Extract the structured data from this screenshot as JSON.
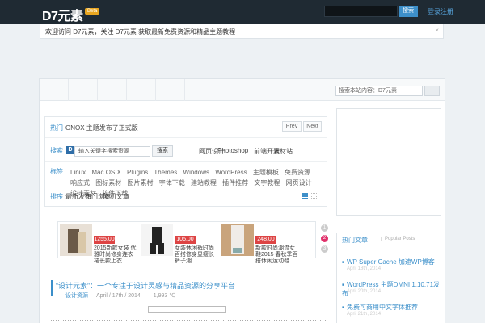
{
  "header": {
    "logo": "D7元素",
    "beta": "Beta",
    "search_value": "",
    "search_button": "搜索",
    "link": "登录注册"
  },
  "notice": {
    "text": "欢迎访问 D7元素，关注 D7元素 获取最新免费资源和精品主题教程",
    "close": "×"
  },
  "sidebar_search": {
    "placeholder": "搜索本站内容：D7元素"
  },
  "filter": {
    "row1": {
      "label": "热门",
      "text": "ONOX 主题发布了正式版",
      "prev": "Prev",
      "next": "Next"
    },
    "row2": {
      "label": "搜索",
      "icon_letter": "D",
      "input": "输入关键字搜索资源",
      "button": "搜索",
      "links": [
        "网页设计",
        "Photoshop",
        "前端开发",
        "素材站"
      ]
    },
    "row3": {
      "label": "标签",
      "tags": [
        "Linux",
        "Mac OS X",
        "Plugins",
        "Themes",
        "Windows",
        "WordPress",
        "主题模板",
        "免费资源",
        "响应式",
        "图标素材",
        "图片素材",
        "字体下载",
        "建站教程",
        "插件推荐",
        "文字教程",
        "网页设计",
        "设计素材",
        "软件下载"
      ]
    },
    "row4": {
      "label": "排序",
      "items": [
        "最新发布",
        "热门浏览",
        "随机文章"
      ]
    }
  },
  "products": [
    {
      "price": "1255.00",
      "desc": "2015新款女装 优雅时尚修身连衣裙长款上衣"
    },
    {
      "price": "105.00",
      "desc": "女装休闲裤时尚百搭修身显瘦长裤子潮"
    },
    {
      "price": "248.00",
      "desc": "新款时尚潮流女鞋2015 春秋季百搭休闲运动鞋"
    }
  ],
  "carousel": [
    "1",
    "2",
    "3"
  ],
  "post": {
    "title": "“设计元素”：一个专注于设计灵感与精品资源的分享平台",
    "category": "设计资源",
    "date": "April / 17th / 2014",
    "views": "1,993 ℃"
  },
  "hot": {
    "tab": "热门文章",
    "tab2": "Popular Posts",
    "items": [
      {
        "title": "WP Super Cache 加速WP博客",
        "date": "April 18th, 2014"
      },
      {
        "title": "WordPress 主题DMNI 1.10.71发布",
        "date": "April 20th, 2014"
      },
      {
        "title": "免费可商用中文字体推荐",
        "date": "April 21th, 2014"
      }
    ]
  }
}
